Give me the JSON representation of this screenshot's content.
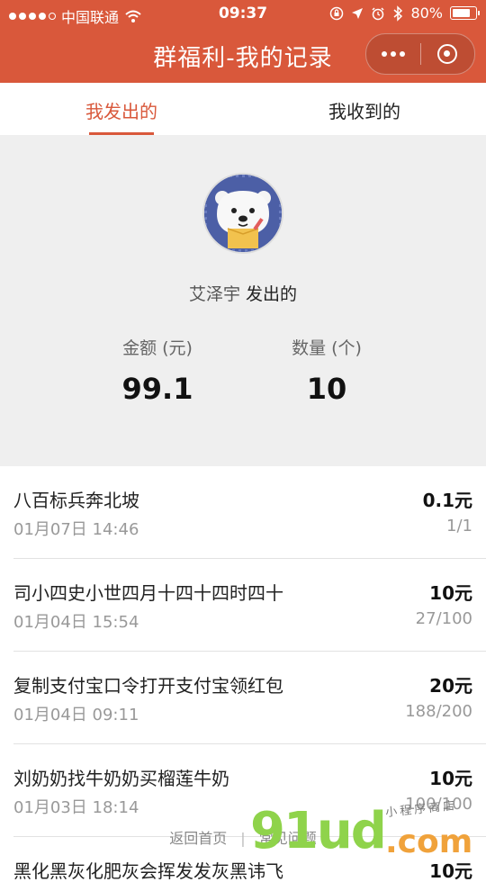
{
  "status_bar": {
    "carrier": "中国联通",
    "time": "09:37",
    "battery": "80%",
    "battery_level": 0.8,
    "signal_bars_filled": 4,
    "icons": [
      "wifi-icon",
      "lock-rotation-icon",
      "location-icon",
      "alarm-icon",
      "bluetooth-icon"
    ]
  },
  "nav": {
    "title": "群福利-我的记录",
    "more_icon": "more-dots-icon",
    "close_icon": "target-close-icon",
    "bg_color": "#d9583b"
  },
  "tabs": [
    {
      "label": "我发出的",
      "active": true
    },
    {
      "label": "我收到的",
      "active": false
    }
  ],
  "summary": {
    "name": "艾泽宇",
    "suffix": "发出的",
    "amount_label": "金额 (元)",
    "amount_value": "99.1",
    "count_label": "数量 (个)",
    "count_value": "10"
  },
  "records": [
    {
      "title": "八百标兵奔北坡",
      "amount": "0.1元",
      "date": "01月07日 14:46",
      "count": "1/1"
    },
    {
      "title": "司小四史小世四月十四十四时四十",
      "amount": "10元",
      "date": "01月04日 15:54",
      "count": "27/100"
    },
    {
      "title": "复制支付宝口令打开支付宝领红包",
      "amount": "20元",
      "date": "01月04日 09:11",
      "count": "188/200"
    },
    {
      "title": "刘奶奶找牛奶奶买榴莲牛奶",
      "amount": "10元",
      "date": "01月03日 18:14",
      "count": "100/100"
    },
    {
      "title": "黑化黑灰化肥灰会挥发发灰黑讳飞",
      "amount": "10元",
      "date": "",
      "count": ""
    }
  ],
  "footer": {
    "home_link": "返回首页",
    "separator": "|",
    "faq_link": "常见问题"
  },
  "watermark": {
    "main": "91ud",
    "suffix": ".com",
    "small": "小程序商店"
  }
}
